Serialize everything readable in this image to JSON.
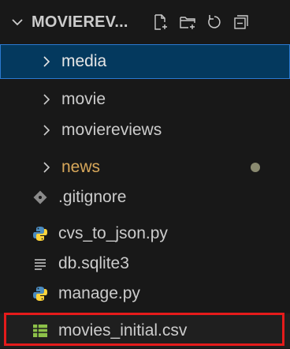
{
  "header": {
    "title": "MOVIEREV...",
    "icons": [
      "new-file-icon",
      "new-folder-icon",
      "refresh-icon",
      "collapse-all-icon"
    ]
  },
  "tree": {
    "folders": [
      {
        "label": "media",
        "selected": true,
        "color": "#e6e6e6"
      },
      {
        "label": "movie",
        "selected": false,
        "color": "#cccccc"
      },
      {
        "label": "moviereviews",
        "selected": false,
        "color": "#cccccc"
      },
      {
        "label": "news",
        "selected": false,
        "color": "#d7a75a",
        "modified": true
      }
    ],
    "files": [
      {
        "label": ".gitignore",
        "icon": "git-icon",
        "color": "#cccccc"
      },
      {
        "label": "cvs_to_json.py",
        "icon": "python-icon",
        "color": "#cccccc"
      },
      {
        "label": "db.sqlite3",
        "icon": "text-file-icon",
        "color": "#cccccc"
      },
      {
        "label": "manage.py",
        "icon": "python-icon",
        "color": "#cccccc"
      },
      {
        "label": "movies_initial.csv",
        "icon": "csv-table-icon",
        "color": "#cccccc",
        "highlighted": true
      }
    ]
  },
  "colors": {
    "background": "#181818",
    "selection": "#04395e",
    "selection_border": "#2b79d0",
    "modified_folder": "#d7a75a",
    "highlight_box": "#e51b1b"
  }
}
